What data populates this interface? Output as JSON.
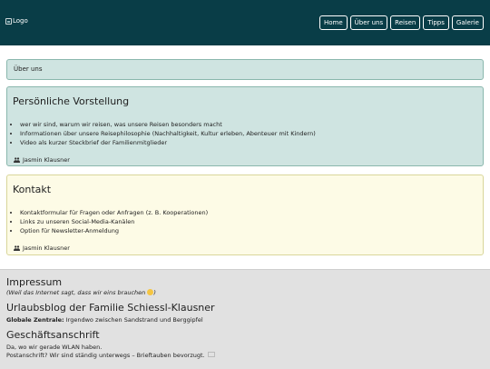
{
  "header": {
    "logo_text": "Logo",
    "nav": [
      "Home",
      "Über uns",
      "Reisen",
      "Tipps",
      "Galerie"
    ]
  },
  "about_bar": {
    "label": "Über uns"
  },
  "sections": [
    {
      "title": "Persönliche Vorstellung",
      "bullets": [
        "wer wir sind, warum wir reisen, was unsere Reisen besonders macht",
        "Informationen über unsere Reisephilosophie (Nachhaltigkeit, Kultur erleben, Abenteuer mit Kindern)",
        "Video als kurzer Steckbrief der Familienmitglieder"
      ],
      "author": "Jasmin Klausner"
    },
    {
      "title": "Kontakt",
      "bullets": [
        "Kontaktformular für Fragen oder Anfragen (z. B. Kooperationen)",
        "Links zu unseren Social-Media-Kanälen",
        "Option für Newsletter-Anmeldung"
      ],
      "author": "Jasmin Klausner"
    }
  ],
  "footer": {
    "impressum_title": "Impressum",
    "impressum_note": "(Weil das Internet sagt, dass wir eins brauchen",
    "impressum_note_end": ")",
    "blog_title": "Urlaubsblog der Familie Schiessl-Klausner",
    "hq_label": "Globale Zentrale:",
    "hq_value": "Irgendwo zwischen Sandstrand und Berggipfel",
    "address_title": "Geschäftsanschrift",
    "address_line1": "Da, wo wir gerade WLAN haben.",
    "address_line2": "Postanschrift? Wir sind ständig unterwegs – Brieftauben bevorzugt."
  },
  "colors": {
    "header_bg": "#093d47",
    "panel_green": "#cfe4e1",
    "panel_cream": "#fdfbe6",
    "footer_bg": "#e1e1e1"
  },
  "icons": [
    "image-placeholder-icon",
    "people-icon",
    "smiley-icon"
  ]
}
